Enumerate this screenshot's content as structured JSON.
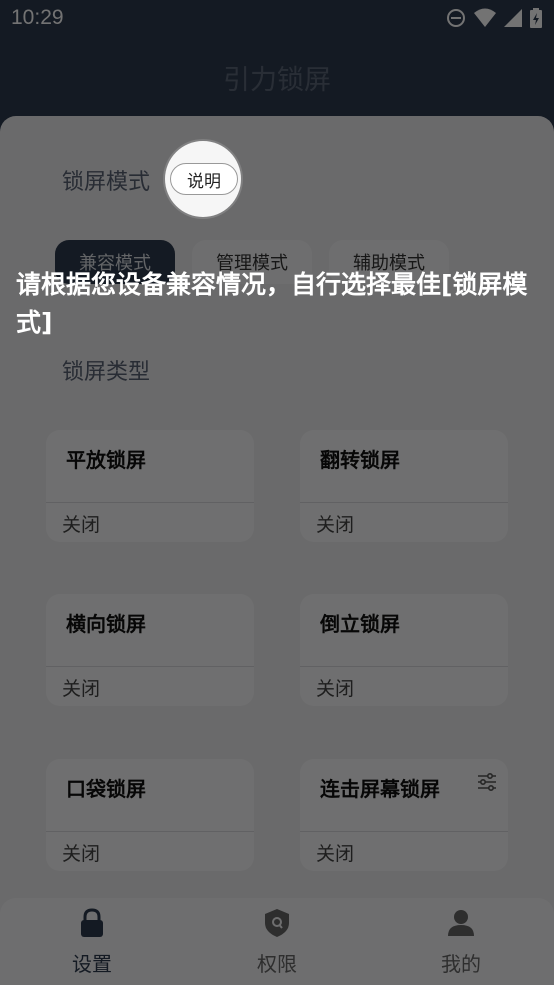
{
  "status_bar": {
    "time": "10:29"
  },
  "header": {
    "title": "引力锁屏"
  },
  "sections": {
    "lock_mode": "锁屏模式",
    "lock_type": "锁屏类型"
  },
  "explain_button": "说明",
  "mode_tabs": [
    {
      "label": "兼容模式",
      "active": true
    },
    {
      "label": "管理模式",
      "active": false
    },
    {
      "label": "辅助模式",
      "active": false
    }
  ],
  "cards": [
    {
      "title": "平放锁屏",
      "status": "关闭"
    },
    {
      "title": "翻转锁屏",
      "status": "关闭"
    },
    {
      "title": "横向锁屏",
      "status": "关闭"
    },
    {
      "title": "倒立锁屏",
      "status": "关闭"
    },
    {
      "title": "口袋锁屏",
      "status": "关闭"
    },
    {
      "title": "连击屏幕锁屏",
      "status": "关闭",
      "icon": "settings-sliders-icon"
    }
  ],
  "tip": "请根据您设备兼容情况，自行选择最佳[锁屏模式]",
  "bottom_nav": [
    {
      "label": "设置",
      "icon": "lock-icon",
      "active": true
    },
    {
      "label": "权限",
      "icon": "shield-icon",
      "active": false
    },
    {
      "label": "我的",
      "icon": "person-icon",
      "active": false
    }
  ]
}
